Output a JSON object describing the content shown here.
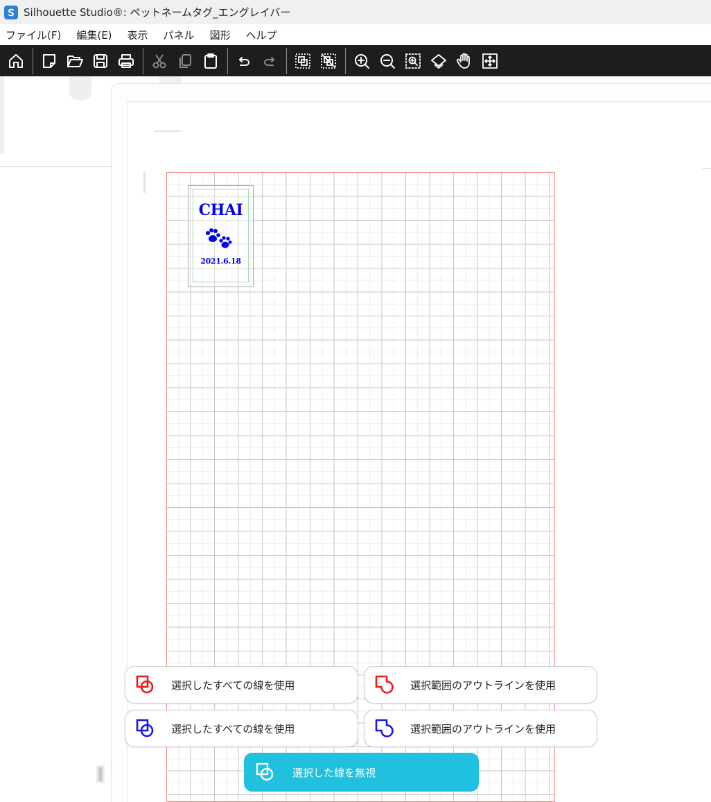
{
  "window": {
    "title": "Silhouette Studio®: ペットネームタグ_エングレイバー"
  },
  "menu": {
    "items": [
      "ファイル(F)",
      "編集(E)",
      "表示",
      "パネル",
      "図形",
      "ヘルプ"
    ]
  },
  "toolbar": {
    "buttons": [
      "home-icon",
      "new-document-icon",
      "open-folder-icon",
      "save-icon",
      "print-icon",
      "cut-icon",
      "copy-icon",
      "paste-icon",
      "undo-icon",
      "redo-icon",
      "group-icon",
      "ungroup-icon",
      "zoom-in-icon",
      "zoom-out-icon",
      "zoom-selection-icon",
      "fit-to-page-icon",
      "pan-hand-icon",
      "move-icon"
    ]
  },
  "design": {
    "tag_title": "CHAI",
    "tag_date": "2021.6.18",
    "text_color": "#0000ee",
    "page_border_color": "#f08a80"
  },
  "options": {
    "red_all_lines": "選択したすべての線を使用",
    "red_outline": "選択範囲のアウトラインを使用",
    "blue_all_lines": "選択したすべての線を使用",
    "blue_outline": "選択範囲のアウトラインを使用",
    "ignore": "選択した線を無視"
  },
  "colors": {
    "toolbar_bg": "#1d1d1d",
    "accent_cyan": "#21c0de",
    "red": "#e81c1c",
    "blue": "#1a1ae0"
  }
}
